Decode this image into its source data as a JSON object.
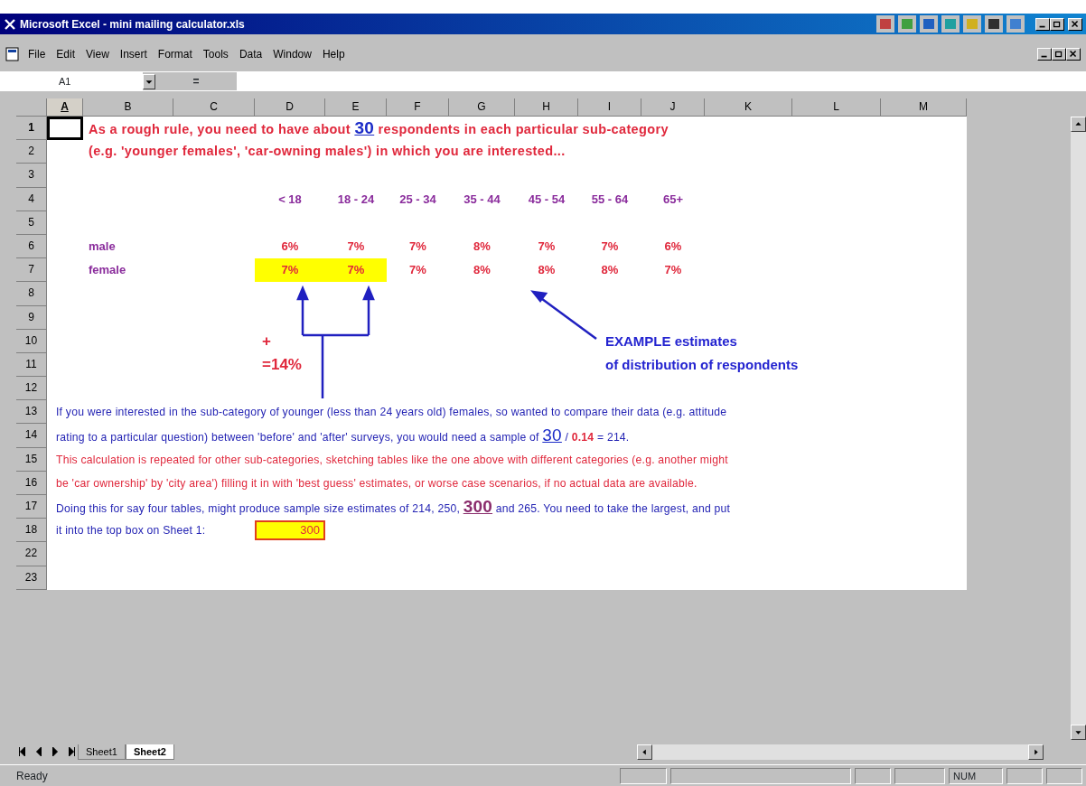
{
  "window": {
    "title": "Microsoft Excel - mini mailing calculator.xls"
  },
  "menu": [
    "File",
    "Edit",
    "View",
    "Insert",
    "Format",
    "Tools",
    "Data",
    "Window",
    "Help"
  ],
  "formula_bar": {
    "name_box": "A1",
    "equals": "="
  },
  "columns": [
    {
      "label": "A",
      "selected": true
    },
    {
      "label": "B",
      "selected": false
    },
    {
      "label": "C",
      "selected": false
    },
    {
      "label": "D",
      "selected": false
    },
    {
      "label": "E",
      "selected": false
    },
    {
      "label": "F",
      "selected": false
    },
    {
      "label": "G",
      "selected": false
    },
    {
      "label": "H",
      "selected": false
    },
    {
      "label": "I",
      "selected": false
    },
    {
      "label": "J",
      "selected": false
    },
    {
      "label": "K",
      "selected": false
    },
    {
      "label": "L",
      "selected": false
    },
    {
      "label": "M",
      "selected": false
    }
  ],
  "rows": [
    {
      "label": "1",
      "selected": true
    },
    {
      "label": "2",
      "selected": false
    },
    {
      "label": "3",
      "selected": false
    },
    {
      "label": "4",
      "selected": false
    },
    {
      "label": "5",
      "selected": false
    },
    {
      "label": "6",
      "selected": false
    },
    {
      "label": "7",
      "selected": false
    },
    {
      "label": "8",
      "selected": false
    },
    {
      "label": "9",
      "selected": false
    },
    {
      "label": "10",
      "selected": false
    },
    {
      "label": "11",
      "selected": false
    },
    {
      "label": "12",
      "selected": false
    },
    {
      "label": "13",
      "selected": false
    },
    {
      "label": "14",
      "selected": false
    },
    {
      "label": "15",
      "selected": false
    },
    {
      "label": "16",
      "selected": false
    },
    {
      "label": "17",
      "selected": false
    },
    {
      "label": "18",
      "selected": false
    },
    {
      "label": "22",
      "selected": false
    },
    {
      "label": "23",
      "selected": false
    }
  ],
  "intro_lines": [
    {
      "segments": [
        {
          "text": "As a rough rule, you need to have about ",
          "kind": "plain"
        },
        {
          "text": "30",
          "kind": "big"
        },
        {
          "text": " respondents in each particular sub-category",
          "kind": "plain"
        }
      ]
    },
    {
      "segments": [
        {
          "text": "(e.g. 'younger females', 'car-owning males') in which you are interested...",
          "kind": "plain"
        }
      ]
    }
  ],
  "age_groups": [
    "< 18",
    "18 - 24",
    "25 - 34",
    "35 - 44",
    "45 - 54",
    "55 - 64",
    "65+"
  ],
  "groups": [
    {
      "label": "male",
      "values": [
        {
          "text": "6%",
          "highlighted": false
        },
        {
          "text": "7%",
          "highlighted": false
        },
        {
          "text": "7%",
          "highlighted": false
        },
        {
          "text": "8%",
          "highlighted": false
        },
        {
          "text": "7%",
          "highlighted": false
        },
        {
          "text": "7%",
          "highlighted": false
        },
        {
          "text": "6%",
          "highlighted": false
        }
      ]
    },
    {
      "label": "female",
      "values": [
        {
          "text": "7%",
          "highlighted": true
        },
        {
          "text": "7%",
          "highlighted": true
        },
        {
          "text": "7%",
          "highlighted": false
        },
        {
          "text": "8%",
          "highlighted": false
        },
        {
          "text": "8%",
          "highlighted": false
        },
        {
          "text": "8%",
          "highlighted": false
        },
        {
          "text": "7%",
          "highlighted": false
        }
      ]
    }
  ],
  "sum_note": [
    "+",
    "=14%"
  ],
  "example_note": [
    "EXAMPLE estimates",
    "of distribution of respondents"
  ],
  "explanation_lines": [
    {
      "color": "#2424b4",
      "segments": [
        {
          "text": "If you were interested in the sub-category of younger (less than 24 years old) females, so wanted to compare their data (e.g. attitude",
          "kind": "plain"
        }
      ]
    },
    {
      "color": "#2424b4",
      "segments": [
        {
          "text": "rating to a particular question) between 'before' and 'after' surveys, you would need a sample of ",
          "kind": "plain"
        },
        {
          "text": "30",
          "kind": "big"
        },
        {
          "text": " / ",
          "kind": "plain"
        },
        {
          "text": "0.14",
          "kind": "bold"
        },
        {
          "text": " = 214.",
          "kind": "plain"
        }
      ]
    },
    {
      "color": "#e0283c",
      "segments": [
        {
          "text": "This calculation is repeated for other sub-categories, sketching tables like the one above with different categories (e.g. another might",
          "kind": "plain"
        }
      ]
    },
    {
      "color": "#e0283c",
      "segments": [
        {
          "text": "be 'car ownership' by 'city area') filling it in with 'best guess' estimates, or worse case scenarios, if no actual data are available.",
          "kind": "plain"
        }
      ]
    },
    {
      "color": "#2424b4",
      "segments": [
        {
          "text": "Doing this for say four tables, might produce sample size estimates of 214, 250, ",
          "kind": "plain"
        },
        {
          "text": "300",
          "kind": "big_purple"
        },
        {
          "text": " and 265.  You need to take the largest, and put",
          "kind": "plain"
        }
      ]
    },
    {
      "color": "#2424b4",
      "segments": [
        {
          "text": "it into the top box on Sheet 1:",
          "kind": "plain"
        }
      ]
    }
  ],
  "answer_cell": "300",
  "sheet_tabs": [
    {
      "label": "Sheet1",
      "selected": false
    },
    {
      "label": "Sheet2",
      "selected": true
    }
  ],
  "status_bar": {
    "message": "Ready",
    "indicator": "NUM"
  }
}
